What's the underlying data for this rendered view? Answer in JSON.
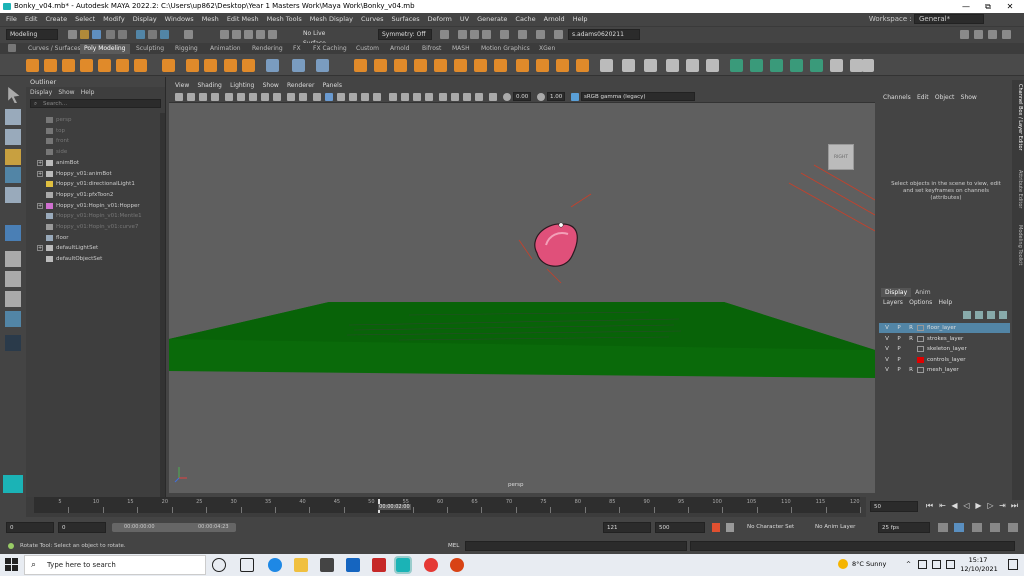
{
  "window": {
    "title": "Bonky_v04.mb* - Autodesk MAYA 2022.2: C:\\Users\\up862\\Desktop\\Year 1 Masters Work\\Maya Work\\Bonky_v04.mb",
    "controls": [
      "—",
      "⧉",
      "✕"
    ]
  },
  "menubar": {
    "items": [
      "File",
      "Edit",
      "Create",
      "Select",
      "Modify",
      "Display",
      "Windows",
      "Mesh",
      "Edit Mesh",
      "Mesh Tools",
      "Mesh Display",
      "Curves",
      "Surfaces",
      "Deform",
      "UV",
      "Generate",
      "Cache",
      "Arnold",
      "Help"
    ],
    "workspace_label": "Workspace :",
    "workspace_value": "General*"
  },
  "statusline": {
    "mode": "Modeling",
    "live_surface": "No Live Surface",
    "symmetry": "Symmetry: Off",
    "user": "s.adams0620211"
  },
  "shelf_tabs": {
    "items": [
      "Curves / Surfaces",
      "Poly Modeling",
      "Sculpting",
      "Rigging",
      "Animation",
      "Rendering",
      "FX",
      "FX Caching",
      "Custom",
      "Arnold",
      "Bifrost",
      "MASH",
      "Motion Graphics",
      "XGen"
    ],
    "active": "Poly Modeling"
  },
  "outliner": {
    "title": "Outliner",
    "menu": [
      "Display",
      "Show",
      "Help"
    ],
    "search_placeholder": "Search...",
    "items": [
      {
        "label": "persp",
        "dim": true,
        "icon": "camera"
      },
      {
        "label": "top",
        "dim": true,
        "icon": "camera"
      },
      {
        "label": "front",
        "dim": true,
        "icon": "camera"
      },
      {
        "label": "side",
        "dim": true,
        "icon": "camera"
      },
      {
        "label": "animBot",
        "dim": false,
        "icon": "group",
        "exp": true
      },
      {
        "label": "Hoppy_v01:animBot",
        "dim": false,
        "icon": "group",
        "exp": true
      },
      {
        "label": "Hoppy_v01:directionalLight1",
        "dim": false,
        "icon": "light"
      },
      {
        "label": "Hoppy_v01:pfxToon2",
        "dim": false,
        "icon": "toon"
      },
      {
        "label": "Hoppy_v01:Hopin_v01:Hopper",
        "dim": false,
        "icon": "joint",
        "exp": true
      },
      {
        "label": "Hoppy_v01:Hopin_v01:Mentle1",
        "dim": true,
        "icon": "mesh"
      },
      {
        "label": "Hoppy_v01:Hopin_v01:curve7",
        "dim": true,
        "icon": "curve"
      },
      {
        "label": "floor",
        "dim": false,
        "icon": "mesh"
      },
      {
        "label": "defaultLightSet",
        "dim": false,
        "icon": "set",
        "exp": true
      },
      {
        "label": "defaultObjectSet",
        "dim": false,
        "icon": "set"
      }
    ]
  },
  "viewport": {
    "menu": [
      "View",
      "Shading",
      "Lighting",
      "Show",
      "Renderer",
      "Panels"
    ],
    "exposure": "0.00",
    "gamma": "1.00",
    "color_space": "sRGB gamma (legacy)",
    "viewcube_label": "RIGHT",
    "camera_label": "persp",
    "floor_color": "#0b6b0b",
    "character_color": "#e0507a"
  },
  "channelbox": {
    "menu": [
      "Channels",
      "Edit",
      "Object",
      "Show"
    ],
    "message": "Select objects in the scene to view, edit and set keyframes on channels (attributes)"
  },
  "right_tabs": [
    "Channel Box / Layer Editor",
    "Attribute Editor",
    "Modeling Toolkit"
  ],
  "layer_editor": {
    "tabs": [
      "Display",
      "Anim"
    ],
    "active_tab": "Display",
    "menu": [
      "Layers",
      "Options",
      "Help"
    ],
    "layers": [
      {
        "v": "V",
        "p": "P",
        "r": "R",
        "name": "floor_layer",
        "selected": true,
        "color": ""
      },
      {
        "v": "V",
        "p": "P",
        "r": "R",
        "name": "strokes_layer",
        "selected": false,
        "color": ""
      },
      {
        "v": "V",
        "p": "P",
        "r": "",
        "name": "skeleton_layer",
        "selected": false,
        "color": ""
      },
      {
        "v": "V",
        "p": "P",
        "r": "",
        "name": "controls_layer",
        "selected": false,
        "color": "#e00000"
      },
      {
        "v": "V",
        "p": "P",
        "r": "R",
        "name": "mesh_layer",
        "selected": false,
        "color": ""
      }
    ]
  },
  "timeslider": {
    "ticks": [
      "5",
      "10",
      "15",
      "20",
      "25",
      "30",
      "35",
      "40",
      "45",
      "50",
      "55",
      "60",
      "65",
      "70",
      "75",
      "80",
      "85",
      "90",
      "95",
      "100",
      "105",
      "110",
      "115",
      "120"
    ],
    "current_time": "00:00:02:00",
    "current_frame_value": 50,
    "range_max": 120,
    "current_field": "50"
  },
  "range": {
    "start": "0",
    "anim_start": "0",
    "slider_start_time": "00:00:00:00",
    "slider_end_time": "00:00:04:23",
    "end": "121",
    "anim_end": "500",
    "character_set": "No Character Set",
    "anim_layer": "No Anim Layer",
    "fps": "25 fps"
  },
  "helpline": {
    "text": "Rotate Tool: Select an object to rotate.",
    "mel_label": "MEL"
  },
  "taskbar": {
    "search_placeholder": "Type here to search",
    "weather": "8°C  Sunny",
    "time": "15:17",
    "date": "12/10/2021"
  }
}
